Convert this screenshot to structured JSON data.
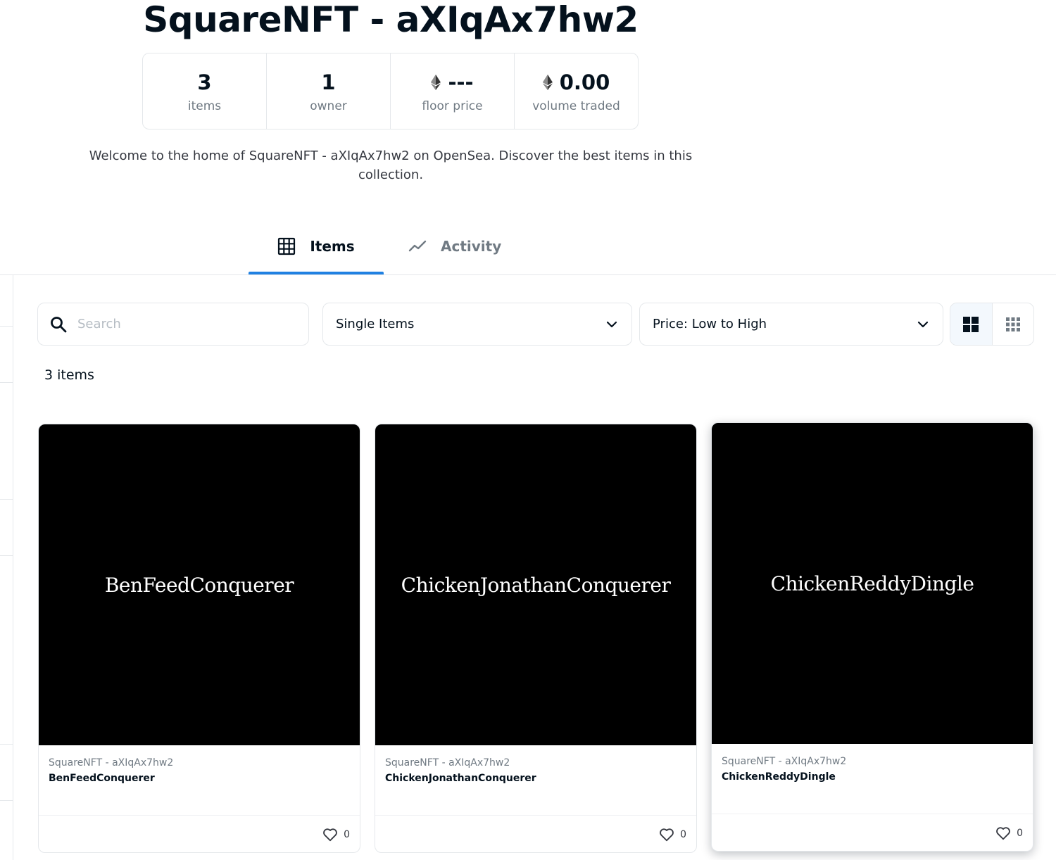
{
  "collection": {
    "title": "SquareNFT - aXIqAx7hw2",
    "description": "Welcome to the home of SquareNFT - aXIqAx7hw2 on OpenSea. Discover the best items in this collection."
  },
  "stats": [
    {
      "value": "3",
      "label": "items",
      "eth_icon": false
    },
    {
      "value": "1",
      "label": "owner",
      "eth_icon": false
    },
    {
      "value": "---",
      "label": "floor price",
      "eth_icon": true
    },
    {
      "value": "0.00",
      "label": "volume traded",
      "eth_icon": true
    }
  ],
  "tabs": [
    {
      "label": "Items",
      "icon": "grid-icon",
      "active": true
    },
    {
      "label": "Activity",
      "icon": "activity-chart-icon",
      "active": false
    }
  ],
  "filters": {
    "search_placeholder": "Search",
    "search_value": "",
    "type_select": "Single Items",
    "sort_select": "Price: Low to High"
  },
  "view_toggle": {
    "active": "large-grid-icon",
    "other": "small-grid-icon"
  },
  "results_count": "3 items",
  "cards": [
    {
      "image_text": "BenFeedConquerer",
      "collection": "SquareNFT - aXIqAx7hw2",
      "name": "BenFeedConquerer",
      "likes": "0"
    },
    {
      "image_text": "ChickenJonathanConquerer",
      "collection": "SquareNFT - aXIqAx7hw2",
      "name": "ChickenJonathanConquerer",
      "likes": "0"
    },
    {
      "image_text": "ChickenReddyDingle",
      "collection": "SquareNFT - aXIqAx7hw2",
      "name": "ChickenReddyDingle",
      "likes": "0"
    }
  ],
  "colors": {
    "accent": "#2081e2",
    "text": "#04111d",
    "muted": "#707a83",
    "border": "#e5e8eb"
  }
}
